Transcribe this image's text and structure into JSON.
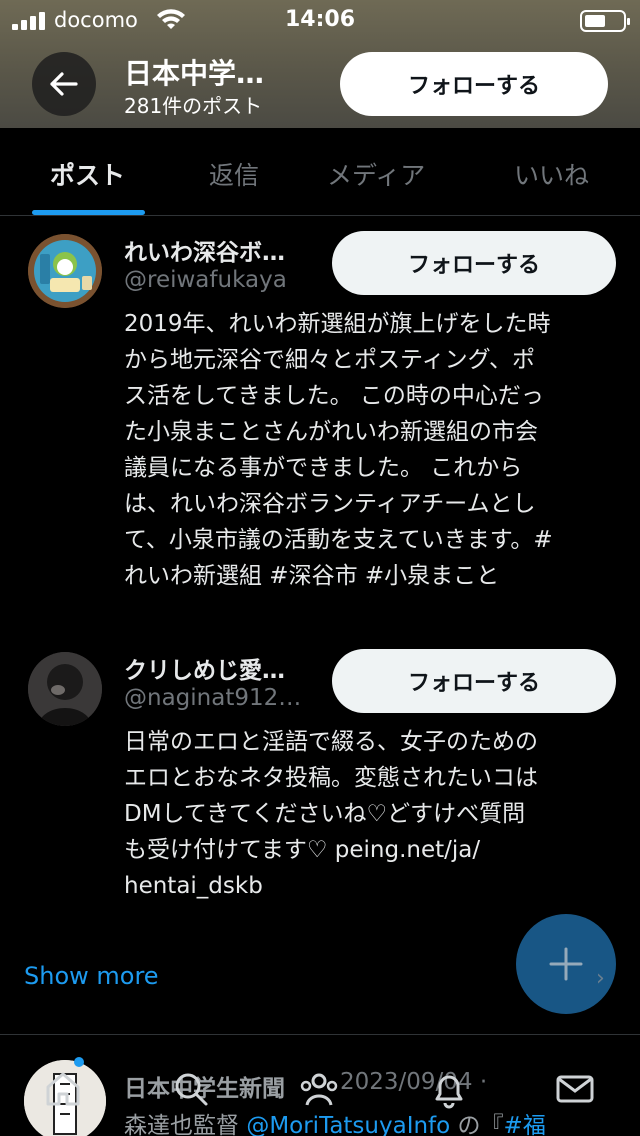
{
  "status_bar": {
    "carrier": "docomo",
    "time": "14:06"
  },
  "header": {
    "title": "日本中学…",
    "post_count": "281件のポスト",
    "follow_label": "フォローする",
    "back_icon": "arrow-left-icon"
  },
  "tabs": [
    {
      "label": "ポスト",
      "active": true
    },
    {
      "label": "返信",
      "active": false
    },
    {
      "label": "メディア",
      "active": false
    },
    {
      "label": "いいね",
      "active": false
    }
  ],
  "users": [
    {
      "name": "れいわ深谷ボ…",
      "handle": "@reiwafukaya",
      "follow_label": "フォローする",
      "bio": "2019年、れいわ新選組が旗上げをした時\nから地元深谷で細々とポスティング、ポ\nス活をしてきました。 この時の中心だっ\nた小泉まことさんがれいわ新選組の市会\n議員になる事ができました。 これから\nは、れいわ深谷ボランティアチームとし\nて、小泉市議の活動を支えていきます。#\nれいわ新選組 #深谷市 #小泉まこと"
    },
    {
      "name": "クリしめじ愛…",
      "handle": "@naginat912…",
      "follow_label": "フォローする",
      "bio": "日常のエロと淫語で綴る、女子のための\nエロとおなネタ投稿。変態されたいコは\nDMしてきてくださいね♡どすけべ質問\nも受け付けてます♡ peing.net/ja/\nhentai_dskb"
    }
  ],
  "show_more": "Show more",
  "tweet": {
    "author": "日本中学生新聞",
    "date": "2023/09/04 ·",
    "text_prefix": "森達也監督 ",
    "mention": "@MoriTatsuyaInfo",
    "text_middle": " の『",
    "hashtag": "#福"
  },
  "colors": {
    "accent": "#1d9bf0",
    "background": "#000000",
    "fab": "#1a5b8d"
  },
  "bottom_nav": [
    "home-icon",
    "search-icon",
    "communities-icon",
    "notifications-icon",
    "messages-icon"
  ]
}
